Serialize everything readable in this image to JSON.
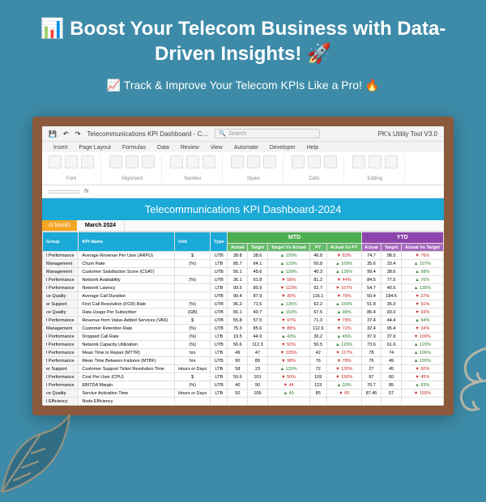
{
  "hero": {
    "title": "📊 Boost Your Telecom Business with Data-Driven Insights! 🚀",
    "subtitle": "📈 Track & Improve Your Telecom KPIs Like a Pro! 🔥"
  },
  "app": {
    "filename": "Telecommunications KPI Dashboard - C…",
    "search_placeholder": "Search",
    "utility": "PK's Utility Tool V3.0"
  },
  "tabs": [
    "Insert",
    "Page Layout",
    "Formulas",
    "Data",
    "Review",
    "View",
    "Automate",
    "Developer",
    "Help"
  ],
  "ribbon_groups": [
    "Font",
    "Alignment",
    "Number",
    "Styles",
    "Cells",
    "Editing"
  ],
  "formula_bar": {
    "cell": "",
    "fx": "fx"
  },
  "dashboard": {
    "title": "Telecommunications KPI Dashboard-2024",
    "month_btn": "ct Month",
    "month": "March 2024"
  },
  "headers": {
    "group": "Group",
    "name": "KPI Name",
    "unit": "Unit",
    "type": "Type",
    "mtd": "MTD",
    "ytd": "YTD",
    "actual": "Actual",
    "target": "Target",
    "tva": "Target Vs Actual",
    "py": "PY",
    "apy": "Actual Vs PY",
    "avt": "Actual Vs Target"
  },
  "rows": [
    {
      "g": "I Performance",
      "n": "Average Revenue Per User (ARPU)",
      "u": "$",
      "t": "UTB",
      "a": "38.8",
      "tg": "38.6",
      "tva": "▲ 100%",
      "py": "46.8",
      "apy": "▼ 83%",
      "ya": "74.7",
      "yt": "98.5",
      "yavt": "▼ 76%"
    },
    {
      "g": "Management",
      "n": "Churn Rate",
      "u": "(%)",
      "t": "LTB",
      "a": "85.7",
      "tg": "64.1",
      "tva": "▲ 133%",
      "py": "50.8",
      "apy": "▲ 169%",
      "ya": "35.6",
      "yt": "33.4",
      "yavt": "▲ 107%"
    },
    {
      "g": "Management",
      "n": "Customer Satisfaction Score (CSAT)",
      "u": "",
      "t": "UTB",
      "a": "56.1",
      "tg": "45.6",
      "tva": "▲ 128%",
      "py": "40.3",
      "apy": "▲ 139%",
      "ya": "99.4",
      "yt": "38.6",
      "yavt": "▲ 98%"
    },
    {
      "g": "I Performance",
      "n": "Network Availability",
      "u": "(%)",
      "t": "UTB",
      "a": "36.1",
      "tg": "61.8",
      "tva": "▼ 58%",
      "py": "81.2",
      "apy": "▼ 44%",
      "ya": "84.5",
      "yt": "77.5",
      "yavt": "▲ 76%"
    },
    {
      "g": "I Performance",
      "n": "Network Latency",
      "u": "",
      "t": "LTB",
      "a": "99.5",
      "tg": "80.9",
      "tva": "▼ 123%",
      "py": "92.7",
      "apy": "▼ 107%",
      "ya": "54.7",
      "yt": "40.5",
      "yavt": "▲ 135%"
    },
    {
      "g": "ce Quality",
      "n": "Average Call Duration",
      "u": "",
      "t": "UTB",
      "a": "90.4",
      "tg": "87.9",
      "tva": "▼ 30%",
      "py": "116.1",
      "apy": "▼ 78%",
      "ya": "50.4",
      "yt": "184.6",
      "yavt": "▼ 27%"
    },
    {
      "g": "er Support",
      "n": "First Call Resolution (FCR) Rate",
      "u": "(%)",
      "t": "UTB",
      "a": "96.2",
      "tg": "71.5",
      "tva": "▲ 135%",
      "py": "62.2",
      "apy": "▲ 155%",
      "ya": "51.8",
      "yt": "35.3",
      "yavt": "▼ 91%"
    },
    {
      "g": "ce Quality",
      "n": "Data Usage Per Subscriber",
      "u": "(GB)",
      "t": "UTB",
      "a": "66.1",
      "tg": "40.7",
      "tva": "▲ 163%",
      "py": "67.5",
      "apy": "▲ 98%",
      "ya": "86.4",
      "yt": "93.0",
      "yavt": "▼ 93%"
    },
    {
      "g": "I Performance",
      "n": "Revenue from Value-Added Services (VAS)",
      "u": "$",
      "t": "UTB",
      "a": "55.8",
      "tg": "57.5",
      "tva": "▼ 97%",
      "py": "71.3",
      "apy": "▼ 78%",
      "ya": "37.4",
      "yt": "44.4",
      "yavt": "▲ 84%"
    },
    {
      "g": "Management",
      "n": "Customer Retention Rate",
      "u": "(%)",
      "t": "UTB",
      "a": "75.3",
      "tg": "85.6",
      "tva": "▼ 88%",
      "py": "112.9",
      "apy": "▼ 72%",
      "ya": "32.4",
      "yt": "95.4",
      "yavt": "▼ 34%"
    },
    {
      "g": "I Performance",
      "n": "Dropped Call Rate",
      "u": "(%)",
      "t": "LTB",
      "a": "19.5",
      "tg": "44.9",
      "tva": "▲ 43%",
      "py": "30.2",
      "apy": "▲ 45%",
      "ya": "37.9",
      "yt": "37.9",
      "yavt": "▼ 100%"
    },
    {
      "g": "I Performance",
      "n": "Network Capacity Utilization",
      "u": "(%)",
      "t": "UTB",
      "a": "56.6",
      "tg": "112.3",
      "tva": "▼ 50%",
      "py": "50.5",
      "apy": "▲ 120%",
      "ya": "73.6",
      "yt": "61.6",
      "yavt": "▲ 120%"
    },
    {
      "g": "I Performance",
      "n": "Mean Time to Repair (MTTR)",
      "u": "hrs",
      "t": "LTB",
      "a": "49",
      "tg": "47",
      "tva": "▼ 105%",
      "py": "42",
      "apy": "▼ 117%",
      "ya": "78",
      "yt": "74",
      "yavt": "▲ 106%"
    },
    {
      "g": "I Performance",
      "n": "Mean Time Between Failures (MTBF)",
      "u": "hrs",
      "t": "UTB",
      "a": "90",
      "tg": "89",
      "tva": "▼ 98%",
      "py": "76",
      "apy": "▼ 78%",
      "ya": "76",
      "yt": "49",
      "yavt": "▲ 155%"
    },
    {
      "g": "er Support",
      "n": "Customer Support Ticket Resolution Time",
      "u": "Hours or Days",
      "t": "LTB",
      "a": "58",
      "tg": "23",
      "tva": "▲ 130%",
      "py": "72",
      "apy": "▼ 130%",
      "ya": "27",
      "yt": "45",
      "yavt": "▼ 60%"
    },
    {
      "g": "I Performance",
      "n": "Cost Per User (CPU)",
      "u": "$",
      "t": "LTB",
      "a": "50.6",
      "tg": "101",
      "tva": "▼ 50%",
      "py": "109",
      "apy": "▼ 150%",
      "ya": "67",
      "yt": "60",
      "yavt": "▼ 45%"
    },
    {
      "g": "I Performance",
      "n": "EBITDA Margin",
      "u": "(%)",
      "t": "UTB",
      "a": "40",
      "tg": "90",
      "tva": "▼ 44",
      "py": "123",
      "apy": "▲ 33%",
      "ya": "70.7",
      "yt": "85",
      "yavt": "▲ 83%"
    },
    {
      "g": "ce Quality",
      "n": "Service Activation Time",
      "u": "Hours or Days",
      "t": "LTB",
      "a": "50",
      "tg": "106",
      "tva": "▲ 49",
      "py": "85",
      "apy": "▼ 60",
      "ya": "87.45",
      "yt": "57",
      "yavt": "▼ 155%"
    },
    {
      "g": "I Efficiency",
      "n": "Node Efficiency",
      "u": "",
      "t": "",
      "a": "",
      "tg": "",
      "tva": "",
      "py": "",
      "apy": "",
      "ya": "",
      "yt": "",
      "yavt": ""
    }
  ]
}
